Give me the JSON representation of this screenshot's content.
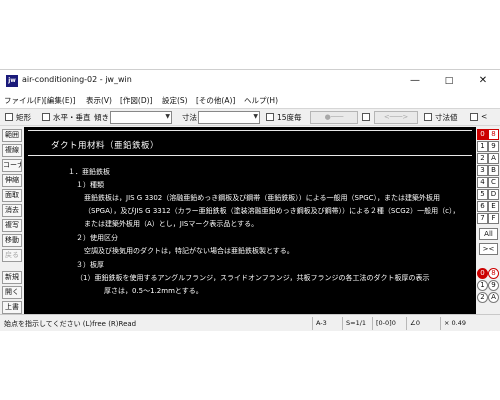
{
  "window": {
    "app_icon": "jw",
    "title": "air-conditioning-02 - jw_win",
    "controls": {
      "minimize": "—",
      "maximize": "□",
      "close": "✕"
    }
  },
  "menu": [
    "ファイル(F)",
    "[編集(E)]",
    "表示(V)",
    "[作図(D)]",
    "設定(S)",
    "[その他(A)]",
    "ヘルプ(H)"
  ],
  "toolbar": {
    "rect_label": "矩形",
    "hv_label": "水平・垂直",
    "tilt_label": "傾き",
    "size_label": "寸法",
    "deg15_label": "15度毎",
    "btn_circle": "●───",
    "btn_arrow": "<───>",
    "dim_value_label": "寸法値",
    "trailing_label": "<"
  },
  "left_tools": [
    {
      "label": "範囲",
      "disabled": false
    },
    {
      "label": "複線",
      "disabled": false
    },
    {
      "label": "コーナー",
      "disabled": false
    },
    {
      "label": "伸縮",
      "disabled": false
    },
    {
      "label": "面取",
      "disabled": false
    },
    {
      "label": "消去",
      "disabled": false
    },
    {
      "label": "複写",
      "disabled": false
    },
    {
      "label": "移動",
      "disabled": false
    },
    {
      "label": "戻る",
      "disabled": true
    },
    {
      "label": "新規",
      "disabled": false
    },
    {
      "label": "開く",
      "disabled": false
    },
    {
      "label": "上書",
      "disabled": false
    }
  ],
  "right_tools": {
    "layer_grid": [
      [
        "0",
        "8"
      ],
      [
        "1",
        "9"
      ],
      [
        "2",
        "A"
      ],
      [
        "3",
        "B"
      ],
      [
        "4",
        "C"
      ],
      [
        "5",
        "D"
      ],
      [
        "6",
        "E"
      ],
      [
        "7",
        "F"
      ]
    ],
    "all_label": "All",
    "cross_label": "><",
    "group_grid": [
      [
        "0",
        "8"
      ],
      [
        "1",
        "9"
      ],
      [
        "2",
        "A"
      ]
    ]
  },
  "document": {
    "title": "ダクト用材料（亜鉛鉄板）",
    "lines": [
      "１．亜鉛鉄板",
      "１）種類",
      "亜鉛鉄板は，JIS G 3302（溶融亜鉛めっき鋼板及び鋼帯（亜鉛鉄板））による一般用（SPGC），または建築外板用",
      "（SPGA），及びJIS G 3312（カラー亜鉛鉄板（塗装溶融亜鉛めっき鋼板及び鋼帯））による２種（SCG2）一般用（c），",
      "または建築外板用（A）とし，JISマーク表示品とする。",
      "２）使用区分",
      "空調及び換気用のダクトは，特記がない場合は亜鉛鉄板製とする。",
      "３）板厚",
      "（1）亜鉛鉄板を使用するアングルフランジ，スライドオンフランジ，共板フランジの各工法のダクト板厚の表示",
      "厚さは，0.5〜1.2mmとする。"
    ]
  },
  "status": {
    "message": "始点を指示してください (L)free (R)Read",
    "paper": "A-3",
    "scale": "S=1/1",
    "layer": "[0-0]0",
    "angle": "∠0",
    "zoom": "× 0.49"
  }
}
